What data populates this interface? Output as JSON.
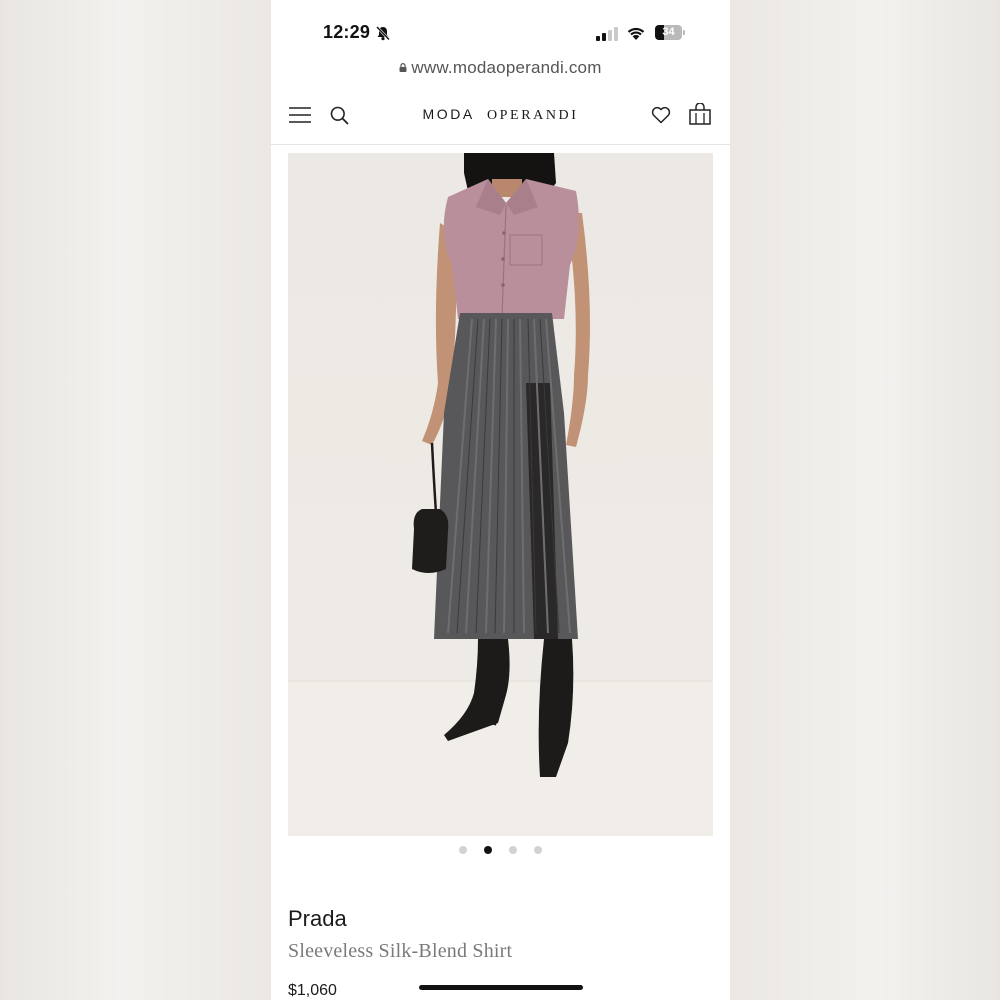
{
  "status_bar": {
    "time": "12:29",
    "battery_level": "34",
    "battery_fraction": 0.34,
    "icons": [
      "bell-off-icon",
      "cell-signal-icon",
      "wifi-icon",
      "battery-icon"
    ]
  },
  "browser": {
    "url": "www.modaoperandi.com",
    "secure_icon": "lock-icon"
  },
  "header": {
    "menu_icon": "hamburger-icon",
    "search_icon": "search-icon",
    "brand_first": "MODA",
    "brand_second": "OPERANDI",
    "wishlist_icon": "heart-icon",
    "bag_icon": "bag-icon"
  },
  "gallery": {
    "image_alt": "Model wearing sleeveless pink shirt, grey fringed skirt and black boots",
    "total_images": 4,
    "active_index": 1
  },
  "product": {
    "designer": "Prada",
    "title": "Sleeveless Silk-Blend Shirt",
    "price": "$1,060"
  },
  "colors": {
    "shirt": "#b88f9a",
    "skirt": "#58585a",
    "boots": "#1c1b1a",
    "background": "#ece8e3"
  }
}
